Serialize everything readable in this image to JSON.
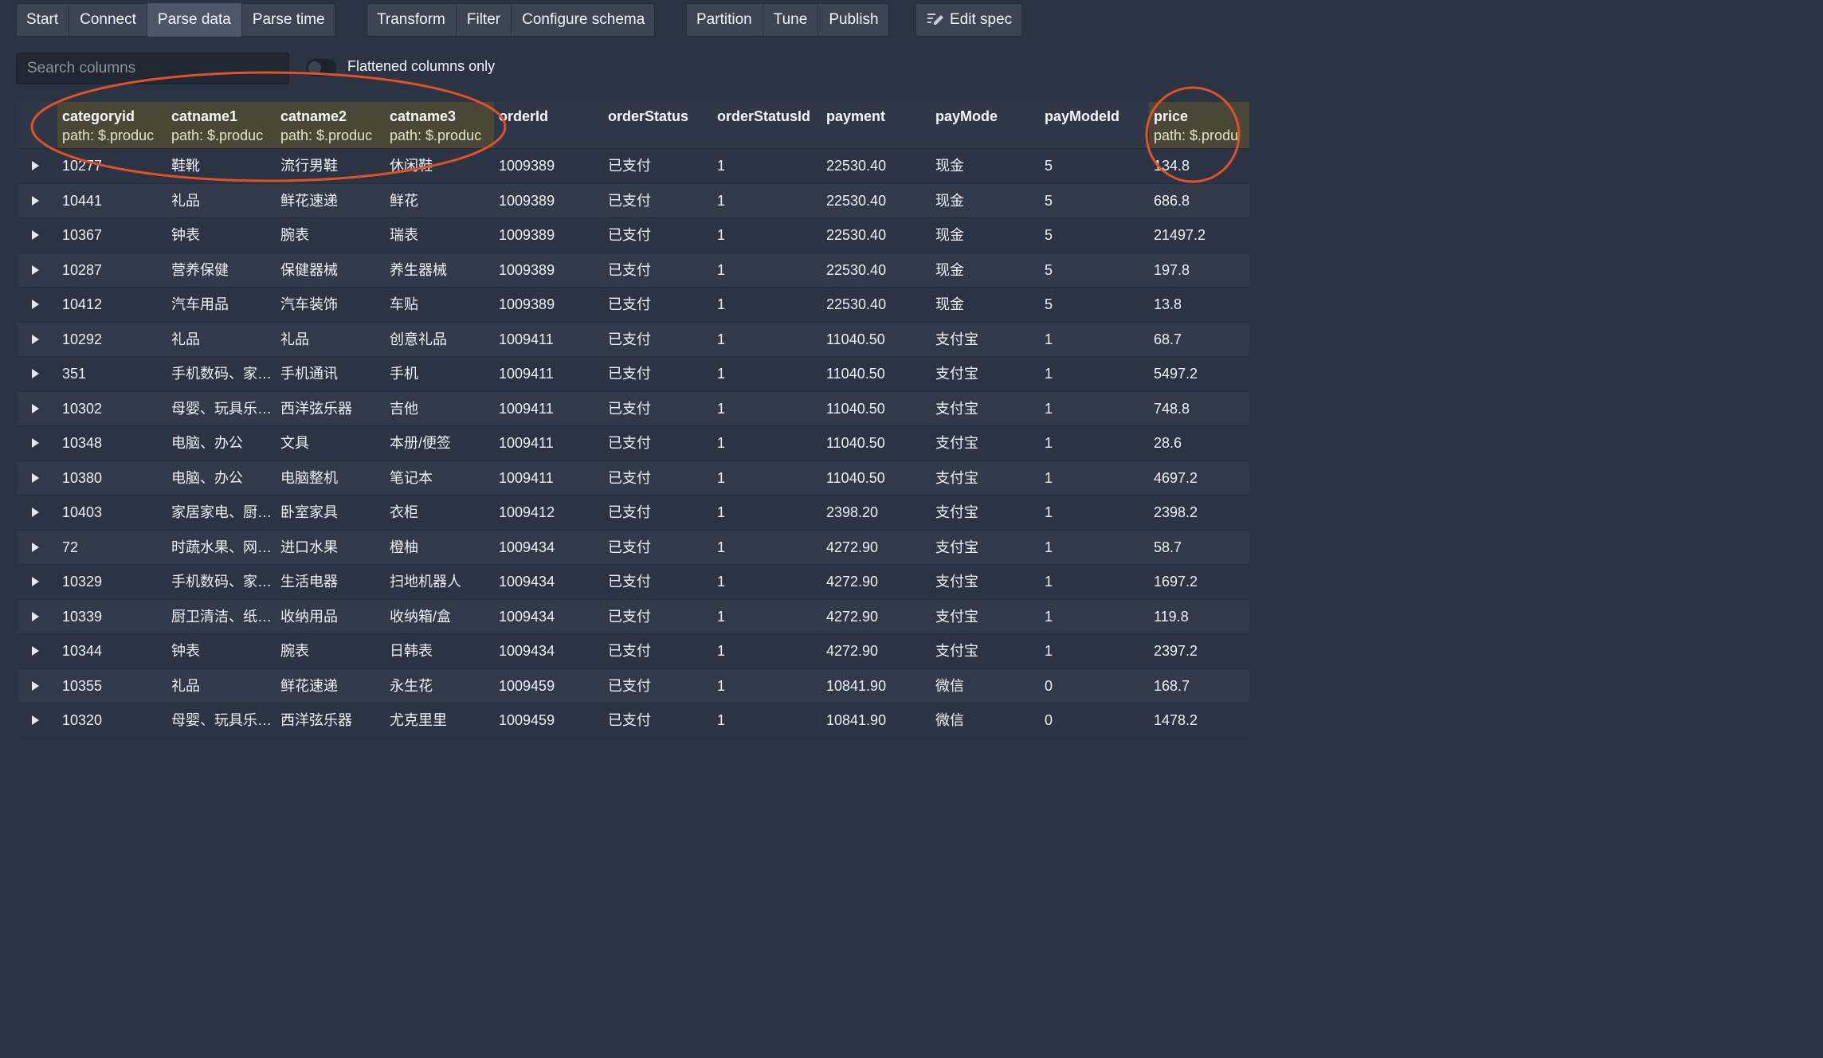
{
  "toolbar": {
    "groups": [
      {
        "buttons": [
          {
            "label": "Start"
          },
          {
            "label": "Connect"
          },
          {
            "label": "Parse data",
            "active": true
          },
          {
            "label": "Parse time"
          }
        ]
      },
      {
        "buttons": [
          {
            "label": "Transform"
          },
          {
            "label": "Filter"
          },
          {
            "label": "Configure schema"
          }
        ]
      },
      {
        "buttons": [
          {
            "label": "Partition"
          },
          {
            "label": "Tune"
          },
          {
            "label": "Publish"
          }
        ]
      },
      {
        "buttons": [
          {
            "label": "Edit spec",
            "icon": "edit-spec-icon"
          }
        ]
      }
    ]
  },
  "search": {
    "placeholder": "Search columns",
    "value": ""
  },
  "flatten_toggle": {
    "label": "Flattened columns only",
    "checked": false
  },
  "columns": [
    {
      "name": "categoryid",
      "path": "path: $.produc",
      "highlighted": true
    },
    {
      "name": "catname1",
      "path": "path: $.produc",
      "highlighted": true
    },
    {
      "name": "catname2",
      "path": "path: $.produc",
      "highlighted": true
    },
    {
      "name": "catname3",
      "path": "path: $.produc",
      "highlighted": true
    },
    {
      "name": "orderId",
      "path": "",
      "highlighted": false
    },
    {
      "name": "orderStatus",
      "path": "",
      "highlighted": false
    },
    {
      "name": "orderStatusId",
      "path": "",
      "highlighted": false
    },
    {
      "name": "payment",
      "path": "",
      "highlighted": false
    },
    {
      "name": "payMode",
      "path": "",
      "highlighted": false
    },
    {
      "name": "payModeId",
      "path": "",
      "highlighted": false
    },
    {
      "name": "price",
      "path": "path: $.produ",
      "highlighted": true
    }
  ],
  "rows": [
    [
      "10277",
      "鞋靴",
      "流行男鞋",
      "休闲鞋",
      "1009389",
      "已支付",
      "1",
      "22530.40",
      "现金",
      "5",
      "134.8"
    ],
    [
      "10441",
      "礼品",
      "鲜花速递",
      "鲜花",
      "1009389",
      "已支付",
      "1",
      "22530.40",
      "现金",
      "5",
      "686.8"
    ],
    [
      "10367",
      "钟表",
      "腕表",
      "瑞表",
      "1009389",
      "已支付",
      "1",
      "22530.40",
      "现金",
      "5",
      "21497.2"
    ],
    [
      "10287",
      "营养保健",
      "保健器械",
      "养生器械",
      "1009389",
      "已支付",
      "1",
      "22530.40",
      "现金",
      "5",
      "197.8"
    ],
    [
      "10412",
      "汽车用品",
      "汽车装饰",
      "车贴",
      "1009389",
      "已支付",
      "1",
      "22530.40",
      "现金",
      "5",
      "13.8"
    ],
    [
      "10292",
      "礼品",
      "礼品",
      "创意礼品",
      "1009411",
      "已支付",
      "1",
      "11040.50",
      "支付宝",
      "1",
      "68.7"
    ],
    [
      "351",
      "手机数码、家…",
      "手机通讯",
      "手机",
      "1009411",
      "已支付",
      "1",
      "11040.50",
      "支付宝",
      "1",
      "5497.2"
    ],
    [
      "10302",
      "母婴、玩具乐…",
      "西洋弦乐器",
      "吉他",
      "1009411",
      "已支付",
      "1",
      "11040.50",
      "支付宝",
      "1",
      "748.8"
    ],
    [
      "10348",
      "电脑、办公",
      "文具",
      "本册/便签",
      "1009411",
      "已支付",
      "1",
      "11040.50",
      "支付宝",
      "1",
      "28.6"
    ],
    [
      "10380",
      "电脑、办公",
      "电脑整机",
      "笔记本",
      "1009411",
      "已支付",
      "1",
      "11040.50",
      "支付宝",
      "1",
      "4697.2"
    ],
    [
      "10403",
      "家居家电、厨…",
      "卧室家具",
      "衣柜",
      "1009412",
      "已支付",
      "1",
      "2398.20",
      "支付宝",
      "1",
      "2398.2"
    ],
    [
      "72",
      "时蔬水果、网…",
      "进口水果",
      "橙柚",
      "1009434",
      "已支付",
      "1",
      "4272.90",
      "支付宝",
      "1",
      "58.7"
    ],
    [
      "10329",
      "手机数码、家…",
      "生活电器",
      "扫地机器人",
      "1009434",
      "已支付",
      "1",
      "4272.90",
      "支付宝",
      "1",
      "1697.2"
    ],
    [
      "10339",
      "厨卫清洁、纸…",
      "收纳用品",
      "收纳箱/盒",
      "1009434",
      "已支付",
      "1",
      "4272.90",
      "支付宝",
      "1",
      "119.8"
    ],
    [
      "10344",
      "钟表",
      "腕表",
      "日韩表",
      "1009434",
      "已支付",
      "1",
      "4272.90",
      "支付宝",
      "1",
      "2397.2"
    ],
    [
      "10355",
      "礼品",
      "鲜花速递",
      "永生花",
      "1009459",
      "已支付",
      "1",
      "10841.90",
      "微信",
      "0",
      "168.7"
    ],
    [
      "10320",
      "母婴、玩具乐…",
      "西洋弦乐器",
      "尤克里里",
      "1009459",
      "已支付",
      "1",
      "10841.90",
      "微信",
      "0",
      "1478.2"
    ]
  ],
  "annotation_color": "#e2502a"
}
